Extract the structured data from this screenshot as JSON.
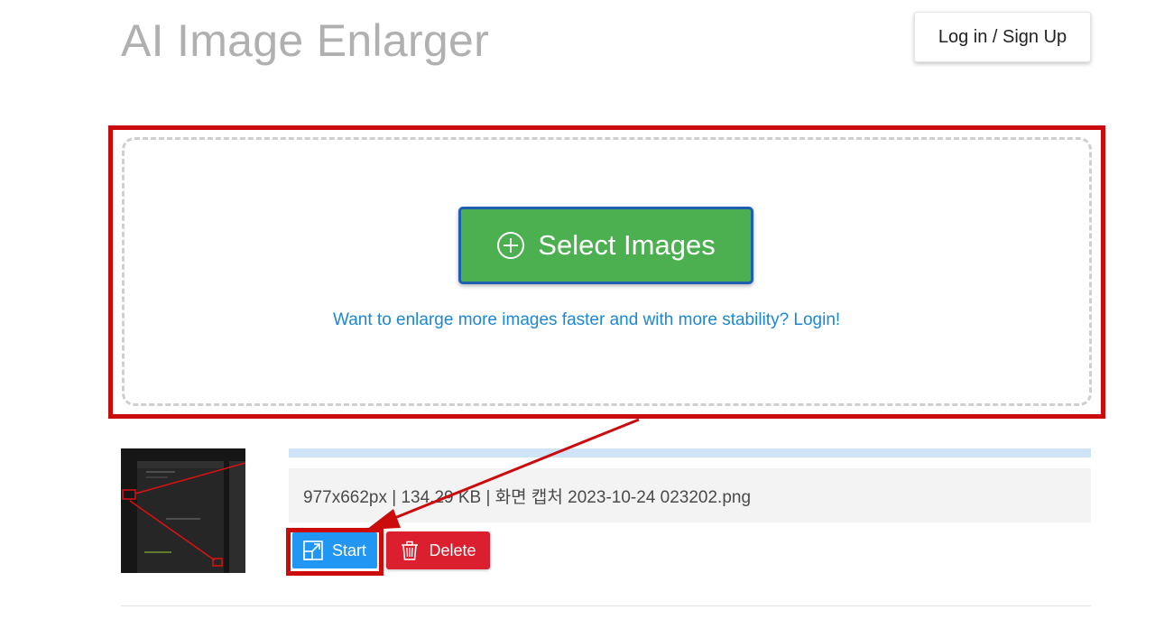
{
  "header": {
    "title": "AI Image Enlarger",
    "login_label": "Log in / Sign Up"
  },
  "upload": {
    "select_label": "Select Images",
    "login_prompt": "Want to enlarge more images faster and with more stability? Login!",
    "select_icon": "plus-circle-icon"
  },
  "file": {
    "info": "977x662px | 134.29 KB | 화면 캡처 2023-10-24 023202.png",
    "progress": 0,
    "start_label": "Start",
    "delete_label": "Delete",
    "start_icon": "enlarge-icon",
    "delete_icon": "trash-icon"
  },
  "colors": {
    "select_button": "#4caf50",
    "start_button": "#2196f3",
    "delete_button": "#dc1f2e",
    "annotation": "#cc0c0c",
    "link": "#1c87d6"
  }
}
